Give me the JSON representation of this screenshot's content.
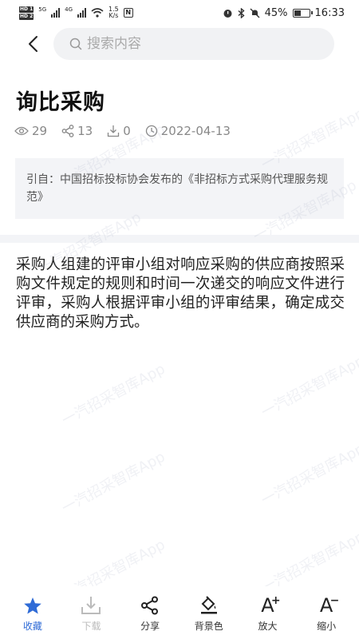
{
  "status_bar": {
    "hd1": "HD 1",
    "hd2": "HD 2",
    "net1": "5G",
    "net2": "4G",
    "speed_value": "1.5",
    "speed_unit": "K/s",
    "nfc": "N",
    "battery": "45%",
    "time": "16:33"
  },
  "search": {
    "placeholder": "搜索内容"
  },
  "article": {
    "title": "询比采购",
    "views": "29",
    "shares": "13",
    "downloads": "0",
    "date": "2022-04-13",
    "citation": "引自：中国招标投标协会发布的《非招标方式采购代理服务规范》",
    "body": "采购人组建的评审小组对响应采购的供应商按照采购文件规定的规则和时间一次递交的响应文件进行评审，采购人根据评审小组的评审结果，确定成交供应商的采购方式。"
  },
  "watermark": "一汽招采智库App",
  "toolbar": {
    "favorite": "收藏",
    "download": "下载",
    "share": "分享",
    "background": "背景色",
    "zoom_in": "放大",
    "zoom_out": "缩小"
  },
  "colors": {
    "accent": "#2f6bd6",
    "disabled": "#bbbbbb"
  }
}
